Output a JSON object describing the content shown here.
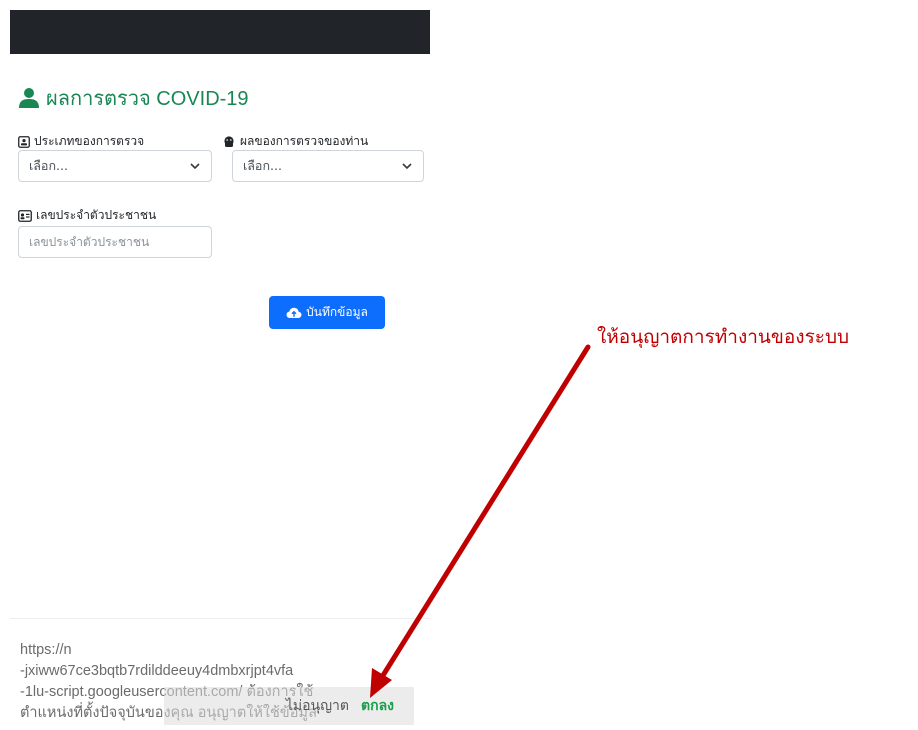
{
  "header": {
    "title": "ผลการตรวจ COVID-19",
    "title_icon": "person-icon",
    "title_color": "#198754",
    "topbar_color": "#212529"
  },
  "form": {
    "test_type": {
      "label": "ประเภทของการตรวจ",
      "icon": "id-card-icon",
      "value": "เลือก..."
    },
    "result": {
      "label": "ผลของการตรวจของท่าน",
      "icon": "virus-mask-icon",
      "value": "เลือก..."
    },
    "citizen_id": {
      "label": "เลขประจำตัวประชาชน",
      "icon": "id-badge-icon",
      "placeholder": "เลขประจำตัวประชาชน",
      "value": ""
    },
    "save_button": {
      "label": "บันทึกข้อมูล",
      "icon": "cloud-upload-icon",
      "color": "#0d6efd"
    }
  },
  "permission_dialog": {
    "lines": [
      "https://n",
      "-jxiww67ce3bqtb7rdilddeeuy4dmbxrjpt4vfa",
      "-1lu-script.googleusercontent.com/ ต้องการใช้",
      "ตำแหน่งที่ตั้งปัจจุบันของคุณ อนุญาตให้ใช้ข้อมูล"
    ],
    "deny_label": "ไม่อนุญาต",
    "allow_label": "ตกลง",
    "allow_color": "#1a9e4b"
  },
  "annotation": {
    "text": "ให้อนุญาตการทำงานของระบบ",
    "color": "#c00000"
  }
}
